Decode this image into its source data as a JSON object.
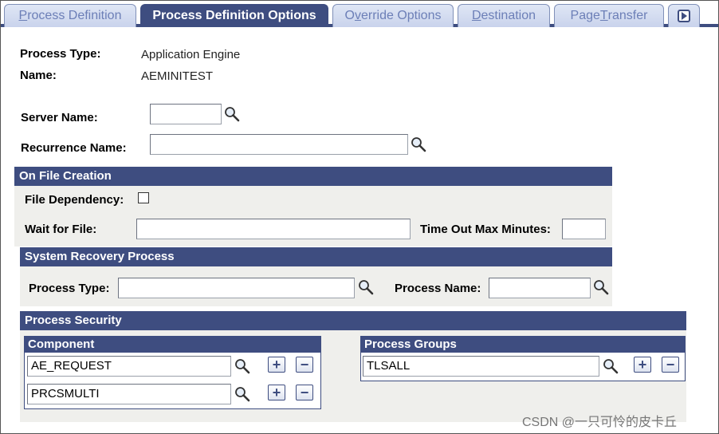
{
  "tabs": [
    {
      "label": "Process Definition",
      "underline": "P",
      "rest": "rocess Definition"
    },
    {
      "label": "Process Definition Options"
    },
    {
      "label": "Override Options",
      "pre": "O",
      "underline": "v",
      "rest": "erride Options"
    },
    {
      "label": "Destination",
      "underline": "D",
      "rest": "estination"
    },
    {
      "label": "Page Transfer",
      "pre": "Page ",
      "underline": "T",
      "rest": "ransfer"
    }
  ],
  "header": {
    "process_type_label": "Process Type:",
    "process_type_value": "Application Engine",
    "name_label": "Name:",
    "name_value": "AEMINITEST"
  },
  "form": {
    "server_name_label": "Server Name:",
    "server_name_value": "",
    "recurrence_name_label": "Recurrence Name:",
    "recurrence_name_value": ""
  },
  "on_file_creation": {
    "title": "On File Creation",
    "file_dependency_label": "File Dependency:",
    "file_dependency_checked": false,
    "wait_for_file_label": "Wait for File:",
    "wait_for_file_value": "",
    "time_out_label": "Time Out Max Minutes:",
    "time_out_value": ""
  },
  "system_recovery": {
    "title": "System Recovery Process",
    "process_type_label": "Process Type:",
    "process_type_value": "",
    "process_name_label": "Process Name:",
    "process_name_value": ""
  },
  "process_security": {
    "title": "Process Security",
    "component_header": "Component",
    "components": [
      "AE_REQUEST",
      "PRCSMULTI"
    ],
    "groups_header": "Process Groups",
    "groups": [
      "TLSALL"
    ]
  },
  "watermark": "CSDN @一只可怜的皮卡丘",
  "colors": {
    "accent": "#3e4d80",
    "section_bg": "#efefec",
    "tab_inactive_text": "#6c7fb7"
  }
}
